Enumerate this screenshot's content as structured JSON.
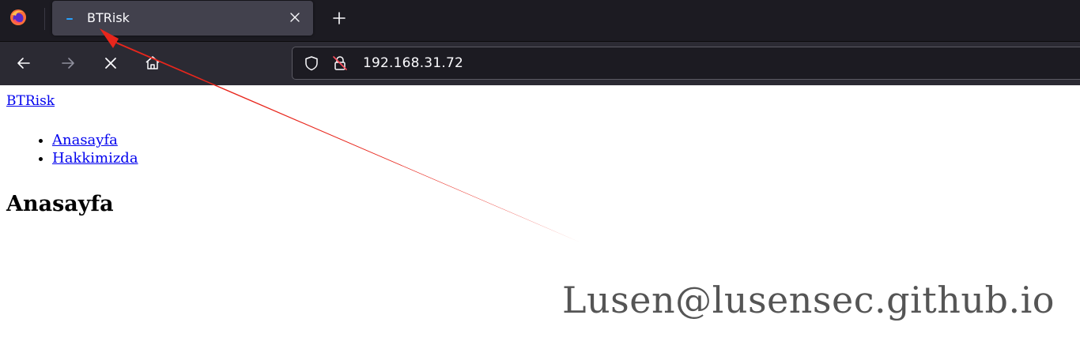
{
  "browser": {
    "tab": {
      "title": "BTRisk",
      "favicon_color": "#27a2ff"
    },
    "icons": {
      "app_logo": "firefox-logo-icon",
      "tab_close": "close-icon",
      "new_tab": "plus-icon",
      "back": "arrow-left-icon",
      "forward": "arrow-right-icon",
      "stop": "close-icon",
      "home": "home-icon",
      "tracking_protection": "shield-icon",
      "connection": "insecure-lock-icon"
    },
    "address_bar": {
      "url": "192.168.31.72"
    },
    "colors": {
      "tabbar_bg": "#1c1b22",
      "navbar_bg": "#2b2a33",
      "active_tab_bg": "#42414d"
    }
  },
  "page": {
    "brand_link": "BTRisk",
    "menu": [
      {
        "label": "Anasayfa"
      },
      {
        "label": "Hakkimizda"
      }
    ],
    "heading": "Anasayfa",
    "link_color": "#0000ee"
  },
  "annotation": {
    "arrow_color": "#e8261c",
    "watermark": "Lusen@lusensec.github.io"
  }
}
